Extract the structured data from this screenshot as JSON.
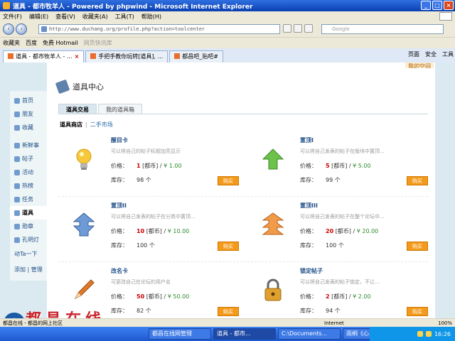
{
  "window": {
    "title": "道具 - 都市牧羊人 - Powered by phpwind - Microsoft Internet Explorer"
  },
  "menu": [
    "文件(F)",
    "编辑(E)",
    "查看(V)",
    "收藏夹(A)",
    "工具(T)",
    "帮助(H)"
  ],
  "address": {
    "url": "http://www.duchang.org/profile.php?action=toolcenter",
    "search_placeholder": "Google"
  },
  "favorites": {
    "label": "收藏夹",
    "items": [
      "百度",
      "免费 Hotmail",
      "网页快讯库"
    ]
  },
  "tabs": [
    {
      "label": "道具 - 都市牧羊人 - ...",
      "active": true
    },
    {
      "label": "手把手教你玩转[道具], ...",
      "active": false
    },
    {
      "label": "都昌吧_贴吧#",
      "active": false
    }
  ],
  "tab_tools": [
    "页面",
    "安全",
    "工具"
  ],
  "page": {
    "login_link": "我的空间",
    "leftnav": [
      {
        "label": "首页",
        "active": false
      },
      {
        "label": "朋友",
        "active": false
      },
      {
        "label": "收藏",
        "active": false
      },
      {
        "label": "新鲜事",
        "active": false,
        "group_gap": true
      },
      {
        "label": "帖子",
        "active": false
      },
      {
        "label": "活动",
        "active": false
      },
      {
        "label": "热榜",
        "active": false
      },
      {
        "label": "任务",
        "active": false
      },
      {
        "label": "道具",
        "active": true
      },
      {
        "label": "勋章",
        "active": false
      },
      {
        "label": "孔明灯",
        "active": false
      }
    ],
    "leftnav_ta": "动Ta一下",
    "leftnav_bottom": [
      "添加",
      "管理"
    ],
    "header_title": "道具中心",
    "tabs": [
      "道具交易",
      "我的道具箱"
    ],
    "subnav": {
      "current": "道具商店",
      "link": "二手市场"
    },
    "labels": {
      "price": "价格：",
      "stock": "库存：",
      "currency": "[都币]",
      "unit": "个",
      "buy": "购买"
    },
    "items": [
      {
        "name": "醒目卡",
        "desc": "可以将自己的帖子标题加亮显示",
        "points": "1",
        "rmb": "¥ 1.00",
        "stock": "98",
        "icon": "lightbulb-icon"
      },
      {
        "name": "置顶I",
        "desc": "可以将自己发表的帖子在版块中置顶...",
        "points": "5",
        "rmb": "¥ 5.00",
        "stock": "99",
        "icon": "up-arrow-green-icon"
      },
      {
        "name": "置顶II",
        "desc": "可以将自己发表的帖子在分类中置顶...",
        "points": "10",
        "rmb": "¥ 10.00",
        "stock": "100",
        "icon": "up-arrow-blue-icon"
      },
      {
        "name": "置顶III",
        "desc": "可以将自己发表的帖子在整个论坛中...",
        "points": "20",
        "rmb": "¥ 20.00",
        "stock": "100",
        "icon": "up-arrow-orange-icon"
      },
      {
        "name": "改名卡",
        "desc": "可更改自己在论坛的用户名",
        "points": "50",
        "rmb": "¥ 50.00",
        "stock": "82",
        "icon": "pencil-icon"
      },
      {
        "name": "锁定帖子",
        "desc": "可以将自己发表的帖子锁定，不让...",
        "points": "2",
        "rmb": "¥ 2.00",
        "stock": "94",
        "icon": "padlock-icon"
      }
    ]
  },
  "watermark": {
    "letter": "e",
    "text": "都昌在线"
  },
  "statusbar": {
    "text": "都昌在线 - 都昌的网上社区",
    "zone": "Internet",
    "zoom": "100%"
  },
  "taskbar": {
    "tasks": [
      "都昌在线网管理",
      "道具 - 都市...",
      "C:\\Documents...",
      "雨桐《心灵地..."
    ],
    "clock": "16:26"
  }
}
